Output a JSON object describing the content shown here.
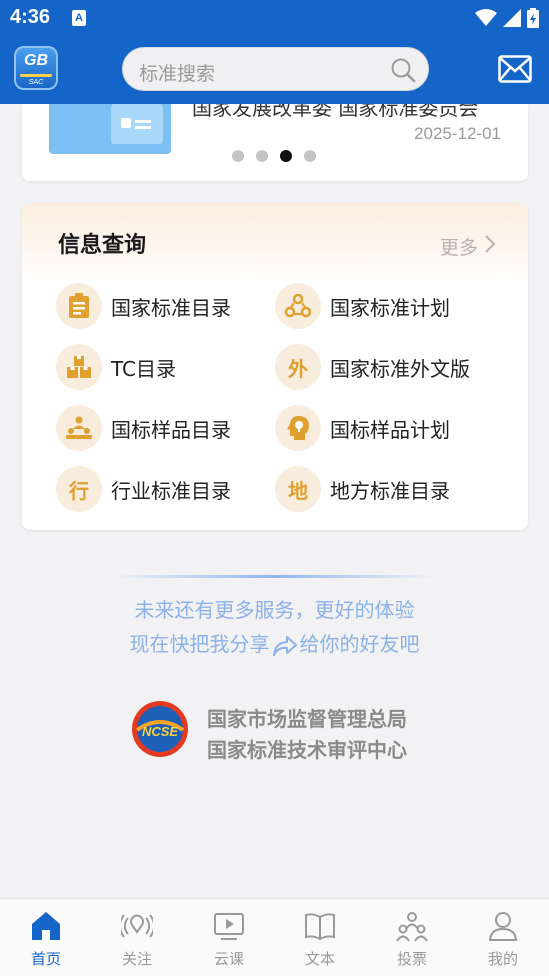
{
  "status_bar": {
    "time": "4:36",
    "notif_glyph": "A"
  },
  "header": {
    "logo_text": "GB",
    "logo_subtext": "SAC",
    "search_placeholder": "标准搜索"
  },
  "banner": {
    "title_fragment": "国家发展改革委 国家标准委员会",
    "date": "2025-12-01",
    "dots_total": 4,
    "dots_active_index": 2
  },
  "info_query": {
    "title": "信息查询",
    "more_label": "更多",
    "items": [
      {
        "icon": "clipboard-icon",
        "glyph": "",
        "label": "国家标准目录"
      },
      {
        "icon": "recycle-icon",
        "glyph": "",
        "label": "国家标准计划"
      },
      {
        "icon": "boxes-icon",
        "glyph": "",
        "label": "TC目录"
      },
      {
        "icon": "wai-badge-icon",
        "glyph": "外",
        "label": "国家标准外文版"
      },
      {
        "icon": "hierarchy-icon",
        "glyph": "",
        "label": "国标样品目录"
      },
      {
        "icon": "head-idea-icon",
        "glyph": "",
        "label": "国标样品计划"
      },
      {
        "icon": "hang-badge-icon",
        "glyph": "行",
        "label": "行业标准目录"
      },
      {
        "icon": "di-badge-icon",
        "glyph": "地",
        "label": "地方标准目录"
      }
    ]
  },
  "share": {
    "line1": "未来还有更多服务，更好的体验",
    "line2_before": "现在快把我分享",
    "line2_after": "给你的好友吧"
  },
  "org": {
    "logo_text": "NCSE",
    "name_line1": "国家市场监督管理总局",
    "name_line2": "国家标准技术审评中心"
  },
  "bottom_nav": {
    "items": [
      {
        "icon": "home-icon",
        "label": "首页",
        "active": true
      },
      {
        "icon": "broadcast-icon",
        "label": "关注",
        "active": false
      },
      {
        "icon": "play-screen-icon",
        "label": "云课",
        "active": false
      },
      {
        "icon": "book-icon",
        "label": "文本",
        "active": false
      },
      {
        "icon": "vote-people-icon",
        "label": "投票",
        "active": false
      },
      {
        "icon": "person-icon",
        "label": "我的",
        "active": false
      }
    ]
  },
  "colors": {
    "primary": "#1565c9",
    "accent_orange": "#e0a030",
    "share_text": "#8bb1ea"
  }
}
